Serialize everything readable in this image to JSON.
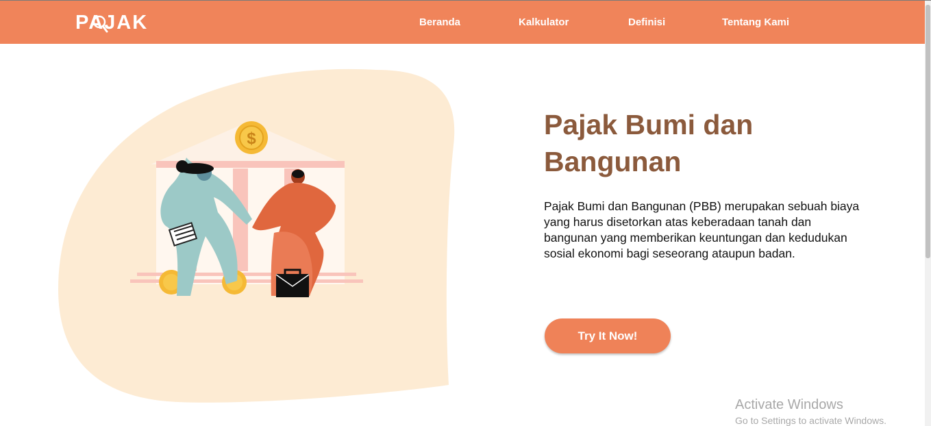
{
  "navbar": {
    "logo_text": "PAJAK",
    "links": [
      {
        "label": "Beranda"
      },
      {
        "label": "Kalkulator"
      },
      {
        "label": "Definisi"
      },
      {
        "label": "Tentang Kami"
      }
    ]
  },
  "hero": {
    "title": "Pajak Bumi dan Bangunan",
    "description": "Pajak Bumi dan Bangunan (PBB) merupakan sebuah biaya yang harus disetorkan atas keberadaan tanah dan bangunan yang memberikan keuntungan dan kedudukan sosial ekonomi bagi seseorang ataupun badan.",
    "cta_label": "Try It Now!",
    "illustration_coin_symbol": "$"
  },
  "watermark": {
    "title": "Activate Windows",
    "subtitle": "Go to Settings to activate Windows."
  },
  "colors": {
    "navbar": "#f0845a",
    "title": "#8b5a3c",
    "button": "#ef8258",
    "blob": "#fdebd3"
  }
}
